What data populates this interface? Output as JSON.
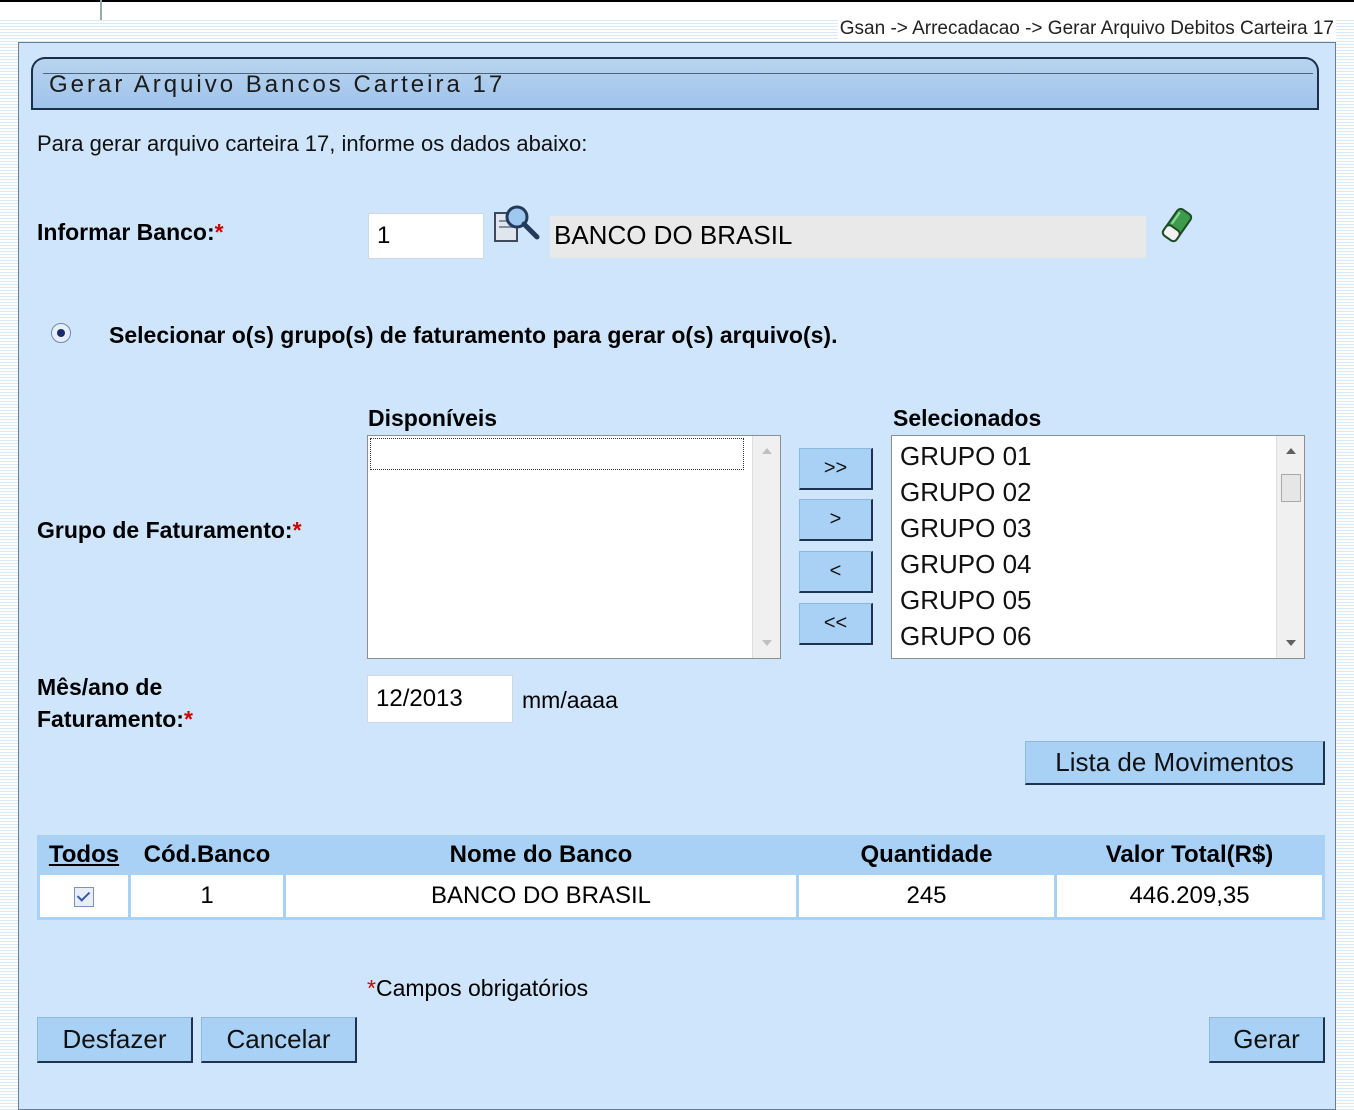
{
  "breadcrumb": "Gsan -> Arrecadacao -> Gerar Arquivo Debitos Carteira 17",
  "form": {
    "title": "Gerar Arquivo Bancos Carteira 17",
    "intro": "Para gerar arquivo carteira 17, informe os dados abaixo:",
    "banco": {
      "label": "Informar Banco:",
      "required_mark": "*",
      "code_value": "1",
      "name_value": "BANCO DO BRASIL",
      "search_icon": "magnifier-icon",
      "clear_icon": "eraser-icon"
    },
    "radio_label": "Selecionar o(s) grupo(s) de faturamento para gerar o(s) arquivo(s).",
    "grupo": {
      "label": "Grupo de Faturamento:",
      "required_mark": "*",
      "available_title": "Disponíveis",
      "selected_title": "Selecionados",
      "available_items": [
        ""
      ],
      "selected_items": [
        "GRUPO 01",
        "GRUPO 02",
        "GRUPO 03",
        "GRUPO 04",
        "GRUPO 05",
        "GRUPO 06"
      ],
      "btn_add_all": ">>",
      "btn_add": ">",
      "btn_remove": "<",
      "btn_remove_all": "<<"
    },
    "mes_ano": {
      "label_line1": "Mês/ano de",
      "label_line2": "Faturamento:",
      "required_mark": "*",
      "value": "12/2013",
      "hint": "mm/aaaa"
    },
    "lista_button": "Lista de Movimentos",
    "table": {
      "headers": {
        "todos": "Todos",
        "cod_banco": "Cód.Banco",
        "nome_banco": "Nome do Banco",
        "quantidade": "Quantidade",
        "valor_total": "Valor Total(R$)"
      },
      "rows": [
        {
          "checked": true,
          "cod_banco": "1",
          "nome_banco": "BANCO DO BRASIL",
          "quantidade": "245",
          "valor_total": "446.209,35"
        }
      ]
    },
    "required_note_mark": "*",
    "required_note": "Campos obrigatórios",
    "buttons": {
      "desfazer": "Desfazer",
      "cancelar": "Cancelar",
      "gerar": "Gerar"
    }
  }
}
